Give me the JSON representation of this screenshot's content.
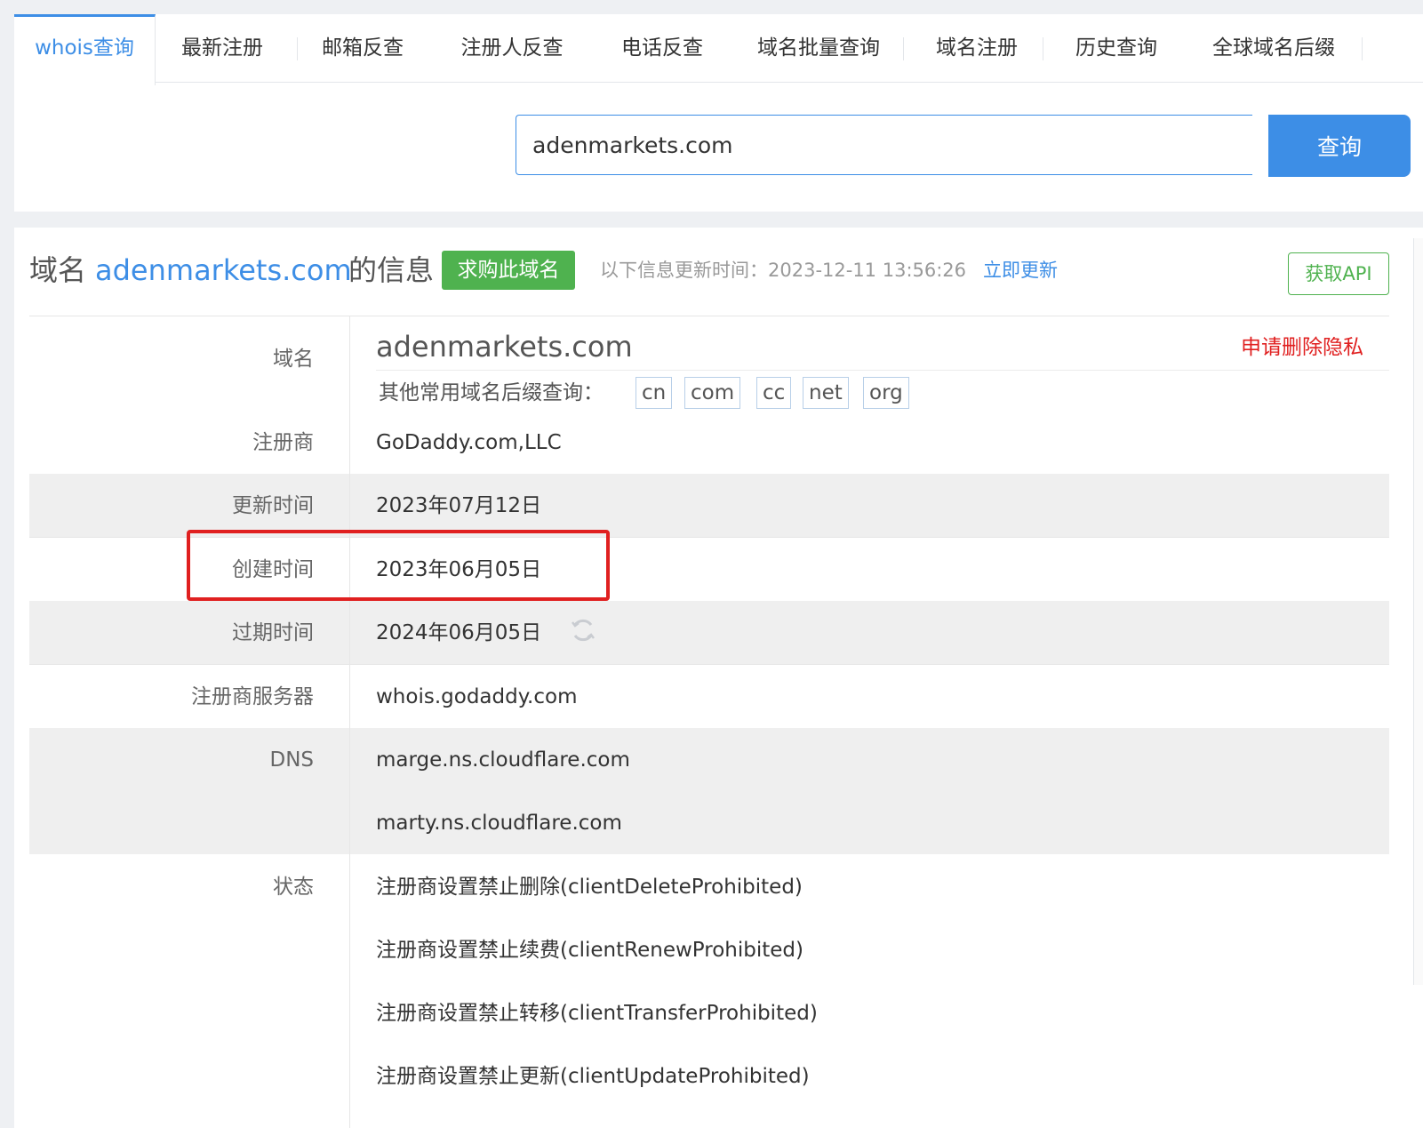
{
  "nav": {
    "tabs": [
      {
        "label": "whois查询",
        "active": true
      },
      {
        "label": "最新注册"
      },
      {
        "label": "邮箱反查"
      },
      {
        "label": "注册人反查"
      },
      {
        "label": "电话反查"
      },
      {
        "label": "域名批量查询"
      },
      {
        "label": "域名注册"
      },
      {
        "label": "历史查询"
      },
      {
        "label": "全球域名后缀"
      }
    ]
  },
  "search": {
    "value": "adenmarkets.com",
    "button_label": "查询"
  },
  "result": {
    "title_prefix": "域名",
    "title_domain": "adenmarkets.com",
    "title_suffix": "的信息",
    "buy_label": "求购此域名",
    "update_label": "以下信息更新时间：2023-12-11 13:56:26",
    "update_link": "立即更新",
    "api_label": "获取API",
    "privacy_link": "申请删除隐私",
    "other_suffix_label": "其他常用域名后缀查询：",
    "suffixes": [
      "cn",
      "com",
      "cc",
      "net",
      "org"
    ],
    "rows": {
      "domain": {
        "label": "域名",
        "value": "adenmarkets.com"
      },
      "registrar": {
        "label": "注册商",
        "value": "GoDaddy.com,LLC"
      },
      "updated": {
        "label": "更新时间",
        "value": "2023年07月12日"
      },
      "created": {
        "label": "创建时间",
        "value": "2023年06月05日"
      },
      "expires": {
        "label": "过期时间",
        "value": "2024年06月05日"
      },
      "whois_server": {
        "label": "注册商服务器",
        "value": "whois.godaddy.com"
      },
      "dns": {
        "label": "DNS",
        "values": [
          "marge.ns.cloudflare.com",
          "marty.ns.cloudflare.com"
        ]
      },
      "status": {
        "label": "状态",
        "values": [
          "注册商设置禁止删除(clientDeleteProhibited)",
          "注册商设置禁止续费(clientRenewProhibited)",
          "注册商设置禁止转移(clientTransferProhibited)",
          "注册商设置禁止更新(clientUpdateProhibited)"
        ]
      }
    }
  },
  "colors": {
    "accent": "#3d8ee6",
    "green": "#4fb24f",
    "red": "#e02020",
    "row_grey": "#efefef"
  }
}
